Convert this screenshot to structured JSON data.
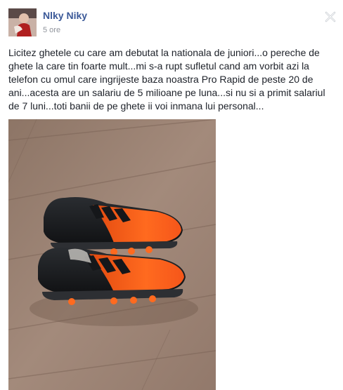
{
  "post": {
    "author": "Nlky Niky",
    "time": "5 ore",
    "text": "Licitez ghetele cu care am debutat la nationala de juniori...o pereche de ghete la care tin foarte mult...mi s-a rupt sufletul cand am vorbit azi la telefon cu omul care ingrijeste baza noastra Pro Rapid de peste 20 de ani...acesta are un salariu de 5 milioane pe luna...si nu si a primit salariul de 7 luni...toti banii de pe ghete ii voi inmana lui personal..."
  },
  "icons": {
    "close": "close-icon",
    "avatar": "profile-photo"
  },
  "colors": {
    "author": "#3b5998",
    "meta": "#90949c",
    "text": "#1d2129",
    "boot_orange": "#ff5a12",
    "boot_black": "#1a1c1f"
  }
}
